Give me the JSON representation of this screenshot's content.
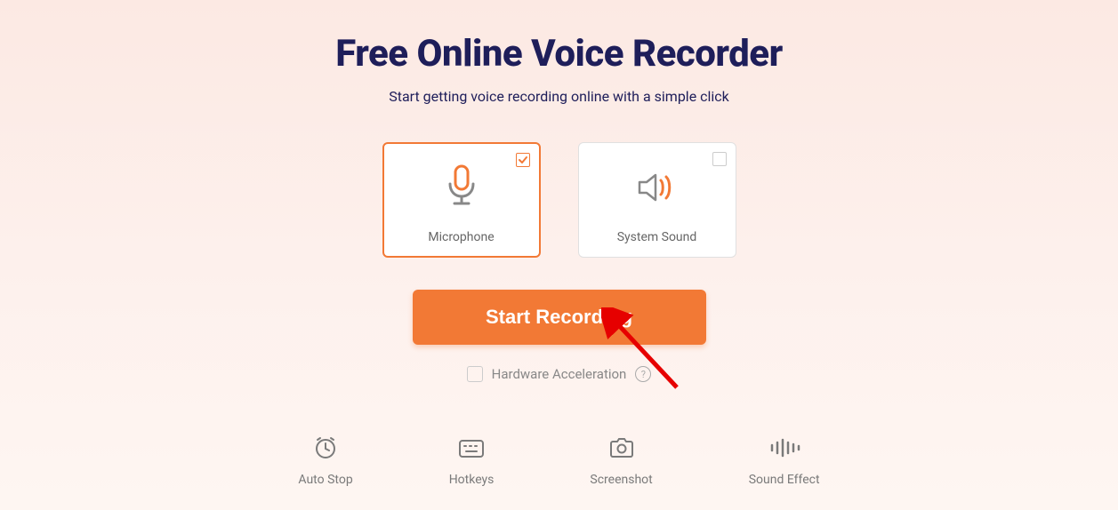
{
  "header": {
    "title": "Free Online Voice Recorder",
    "subtitle": "Start getting voice recording online with a simple click"
  },
  "sources": {
    "microphone": {
      "label": "Microphone",
      "selected": true
    },
    "system_sound": {
      "label": "System Sound",
      "selected": false
    }
  },
  "actions": {
    "start_label": "Start Recording"
  },
  "hardware_accel": {
    "label": "Hardware Acceleration",
    "checked": false
  },
  "features": {
    "auto_stop": "Auto Stop",
    "hotkeys": "Hotkeys",
    "screenshot": "Screenshot",
    "sound_effect": "Sound Effect"
  },
  "colors": {
    "accent": "#f27935",
    "text_dark": "#1e1e5a"
  }
}
